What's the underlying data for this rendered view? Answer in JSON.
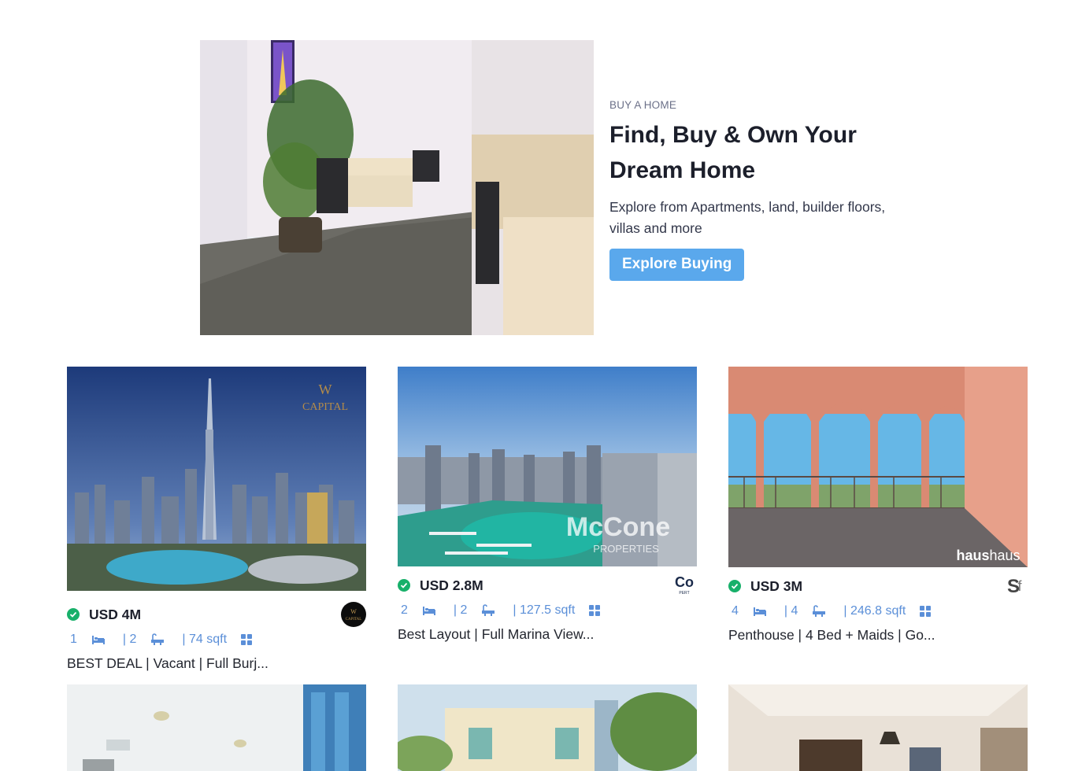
{
  "hero": {
    "eyebrow": "BUY A HOME",
    "title_line1": "Find, Buy & Own Your",
    "title_line2": "Dream Home",
    "subtitle": "Explore from Apartments, land, builder floors, villas and more",
    "cta_label": "Explore Buying"
  },
  "listings": [
    {
      "price": "USD 4M",
      "beds": "1",
      "baths": "| 2",
      "area": "| 74 sqft",
      "title": "BEST DEAL | Vacant | Full Burj...",
      "agency_icon": "capital-logo"
    },
    {
      "price": "USD 2.8M",
      "beds": "2",
      "baths": "| 2",
      "area": "| 127.5 sqft",
      "title": "Best Layout | Full Marina View...",
      "agency_icon": "mccone-logo"
    },
    {
      "price": "USD 3M",
      "beds": "4",
      "baths": "| 4",
      "area": "| 246.8 sqft",
      "title": "Penthouse | 4 Bed + Maids | Go...",
      "agency_icon": "haus-logo"
    }
  ],
  "colors": {
    "accent": "#5aa8ec",
    "verified": "#18b06a",
    "spec_text": "#5b8fd8"
  }
}
